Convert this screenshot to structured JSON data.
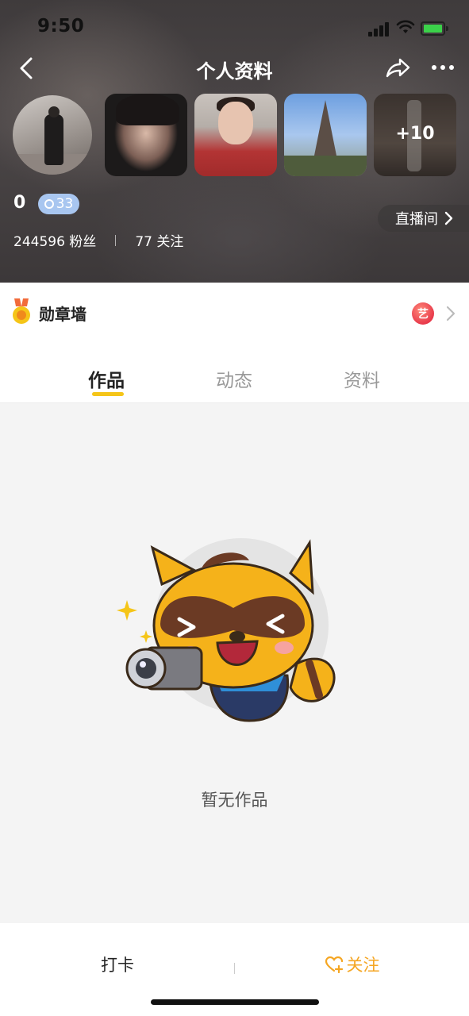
{
  "status_bar": {
    "time": "9:50"
  },
  "header": {
    "title": "个人资料",
    "photos_more_count": "+10",
    "level": "0",
    "coin_badge": "33",
    "live_room_label": "直播间",
    "stats": {
      "fans": "244596 粉丝",
      "following": "77 关注"
    }
  },
  "medal_wall": {
    "label": "勋章墙",
    "badge_text": "艺"
  },
  "tabs": [
    {
      "label": "作品",
      "active": true
    },
    {
      "label": "动态",
      "active": false
    },
    {
      "label": "资料",
      "active": false
    }
  ],
  "empty_state": {
    "text": "暂无作品"
  },
  "bottom_bar": {
    "checkin_label": "打卡",
    "follow_label": "关注"
  },
  "colors": {
    "accent": "#f5c518",
    "follow": "#f5a623",
    "coin_badge": "#a8c6f0",
    "medal_badge": "#e83a4b"
  },
  "icons": [
    "back-arrow-icon",
    "share-icon",
    "more-icon",
    "signal-icon",
    "wifi-icon",
    "battery-icon",
    "medal-icon",
    "chevron-right-icon",
    "heart-plus-icon",
    "coin-icon"
  ]
}
